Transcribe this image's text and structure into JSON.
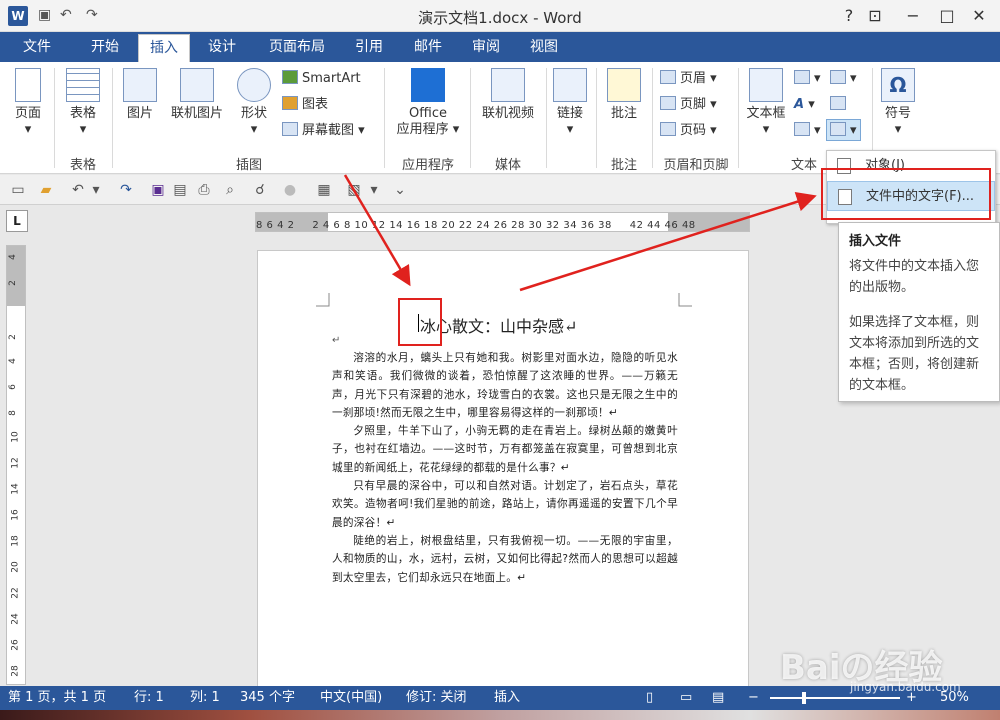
{
  "window": {
    "title": "演示文档1.docx - Word",
    "controls": [
      "?",
      "−",
      "□",
      "✕"
    ]
  },
  "tabs": [
    "文件",
    "开始",
    "插入",
    "设计",
    "页面布局",
    "引用",
    "邮件",
    "审阅",
    "视图"
  ],
  "active_tab": "插入",
  "ribbon": {
    "page": {
      "label": "页面"
    },
    "tables": {
      "button": "表格",
      "group": "表格"
    },
    "illustrations": {
      "group": "插图",
      "picture": "图片",
      "online_picture": "联机图片",
      "shapes": "形状",
      "smartart": "SmartArt",
      "chart": "图表",
      "screenshot": "屏幕截图"
    },
    "apps": {
      "office_line1": "Office",
      "office_line2": "应用程序",
      "group": "应用程序"
    },
    "media": {
      "online_video": "联机视频",
      "group": "媒体"
    },
    "links": {
      "label": "链接"
    },
    "comments": {
      "label": "批注",
      "group": "批注"
    },
    "header_footer": {
      "header": "页眉",
      "footer": "页脚",
      "page_number": "页码",
      "group": "页眉和页脚"
    },
    "text": {
      "textbox": "文本框",
      "group": "文本"
    },
    "symbols": {
      "label": "符号",
      "omega": "Ω"
    }
  },
  "object_menu": {
    "object": "对象(J)",
    "text_from_file": "文件中的文字(F)..."
  },
  "tooltip": {
    "title": "插入文件",
    "para1": "将文件中的文本插入您的出版物。",
    "para2": "如果选择了文本框，则文本将添加到所选的文本框；否则，将创建新的文本框。"
  },
  "ruler": {
    "corner": "L",
    "numbers": "8 6 4 2 　 2 4 6 8 10 12 14 16 18 20 22 24 26 28 30 32 34 36 38 　 42 44 46 48",
    "vertical": [
      "4",
      "2",
      "2",
      "4",
      "6",
      "8",
      "10",
      "12",
      "14",
      "16",
      "18",
      "20",
      "22",
      "24",
      "26",
      "28"
    ]
  },
  "document": {
    "title": "冰心散文：山中杂感↵",
    "blank": "↵",
    "paragraphs": [
      "溶溶的水月，螭头上只有她和我。树影里对面水边，隐隐的听见水声和笑语。我们微微的谈着，恐怕惊醒了这浓睡的世界。——万籁无声，月光下只有深碧的池水，玲珑雪白的衣裳。这也只是无限之生中的一刹那顷!然而无限之生中，哪里容易得这样的一刹那顷！↵",
      "夕照里，牛羊下山了，小驹无羁的走在青岩上。绿树丛颠的嫩黄叶子，也衬在红墙边。——这时节，万有都笼盖在寂寞里，可曾想到北京城里的新闻纸上，花花绿绿的都载的是什么事？↵",
      "只有早晨的深谷中，可以和自然对语。计划定了，岩石点头，草花欢笑。造物者呵!我们星驰的前途，路站上，请你再遥遥的安置下几个早晨的深谷！↵",
      "陡绝的岩上，树根盘结里，只有我俯视一切。——无限的宇宙里，人和物质的山，水，远村，云树，又如何比得起?然而人的思想可以超越到太空里去，它们却永远只在地面上。↵"
    ]
  },
  "status": {
    "page": "第 1 页，共 1 页",
    "row": "行: 1",
    "col": "列: 1",
    "words": "345 个字",
    "lang": "中文(中国)",
    "track": "修订: 关闭",
    "mode": "插入",
    "zoom": "50%"
  },
  "watermark": {
    "main": "Baiの经验",
    "sub": "jingyan.baidu.com"
  },
  "colors": {
    "accent": "#2b579a",
    "highlight_box": "#e0221e",
    "menu_highlight": "#cde4f7"
  }
}
